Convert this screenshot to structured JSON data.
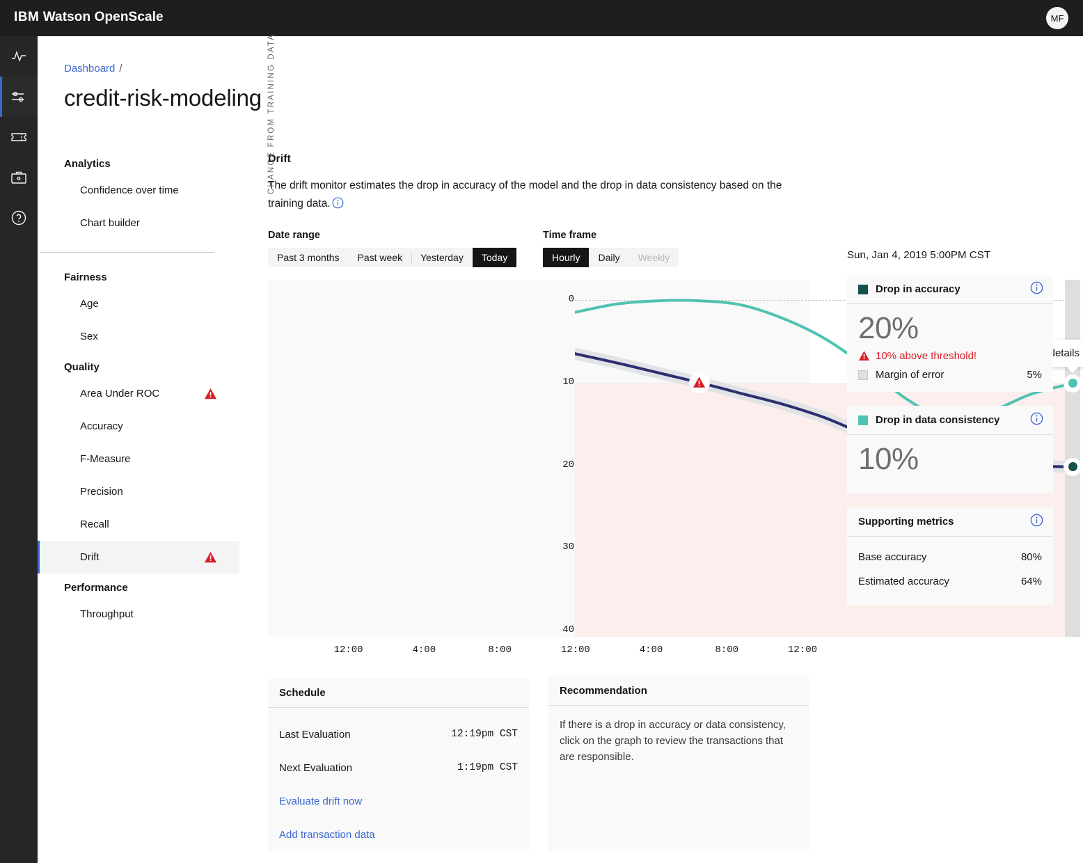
{
  "topbar": {
    "brand_ibm": "IBM",
    "brand_product": "Watson OpenScale",
    "avatar_initials": "MF"
  },
  "rail": {
    "items": [
      {
        "icon": "activity-icon",
        "active": false
      },
      {
        "icon": "sliders-icon",
        "active": true
      },
      {
        "icon": "ticket-icon",
        "active": false
      },
      {
        "icon": "briefcase-icon",
        "active": false
      },
      {
        "icon": "help-icon",
        "active": false
      }
    ]
  },
  "breadcrumb": {
    "parent": "Dashboard",
    "separator": "/"
  },
  "page_title": "credit-risk-modeling",
  "nav": {
    "groups": [
      {
        "heading": "Analytics",
        "items": [
          {
            "label": "Confidence over time",
            "warning": false,
            "selected": false
          },
          {
            "label": "Chart builder",
            "warning": false,
            "selected": false
          }
        ]
      },
      {
        "heading": "Fairness",
        "items": [
          {
            "label": "Age",
            "warning": false,
            "selected": false
          },
          {
            "label": "Sex",
            "warning": false,
            "selected": false
          }
        ]
      },
      {
        "heading": "Quality",
        "items": [
          {
            "label": "Area Under ROC",
            "warning": true,
            "selected": false
          },
          {
            "label": "Accuracy",
            "warning": false,
            "selected": false
          },
          {
            "label": "F-Measure",
            "warning": false,
            "selected": false
          },
          {
            "label": "Precision",
            "warning": false,
            "selected": false
          },
          {
            "label": "Recall",
            "warning": false,
            "selected": false
          },
          {
            "label": "Drift",
            "warning": true,
            "selected": true
          }
        ]
      },
      {
        "heading": "Performance",
        "items": [
          {
            "label": "Throughput",
            "warning": false,
            "selected": false
          }
        ]
      }
    ]
  },
  "section": {
    "title": "Drift",
    "description": "The drift monitor estimates the drop in accuracy of the model and the drop in data consistency based on the training data."
  },
  "controls": {
    "date_range": {
      "label": "Date range",
      "options": [
        "Past 3 months",
        "Past week",
        "Yesterday",
        "Today"
      ],
      "selected": "Today"
    },
    "time_frame": {
      "label": "Time frame",
      "options": [
        "Hourly",
        "Daily",
        "Weekly"
      ],
      "selected": "Hourly",
      "disabled": [
        "Weekly"
      ]
    }
  },
  "chart_tooltip": "Click to view details",
  "chart_data": {
    "type": "line",
    "title": "Drift",
    "xlabel": "",
    "ylabel": "CHANGE FROM TRAINING DATA",
    "x_ticks": [
      "12:00",
      "4:00",
      "8:00",
      "12:00",
      "4:00",
      "8:00",
      "12:00"
    ],
    "y_ticks": [
      0,
      10,
      20,
      30,
      40
    ],
    "ylim": [
      0,
      44
    ],
    "y_inverted": true,
    "grid": "horizontal-dashed",
    "legend_position": "right-panel",
    "threshold": 10,
    "threshold_band_color": "#fbeeec",
    "series": [
      {
        "name": "Drop in accuracy",
        "color": "#2d2f6f",
        "end_marker_color": "#17514f",
        "has_margin_band": true,
        "margin_band_color": "#dfe3e6",
        "margin_of_error": 5,
        "x": [
          0,
          4,
          8,
          12,
          16,
          20,
          24,
          28,
          32,
          36,
          40,
          44,
          48
        ],
        "values": [
          6.5,
          7.6,
          8.8,
          10.0,
          11.3,
          12.6,
          14.2,
          16.3,
          18.3,
          19.8,
          20.1,
          20.1,
          20.2
        ]
      },
      {
        "name": "Drop in data consistency",
        "color": "#4fc3b1",
        "end_marker_color": "#4fc3b1",
        "has_margin_band": false,
        "x": [
          0,
          4,
          8,
          12,
          16,
          20,
          24,
          28,
          32,
          36,
          40,
          44,
          48
        ],
        "values": [
          1.5,
          0.5,
          0.1,
          0.1,
          0.6,
          2.2,
          4.6,
          8.0,
          12.0,
          14.4,
          13.5,
          11.4,
          10.1
        ]
      }
    ],
    "alert_markers": [
      {
        "series": "Drop in accuracy",
        "x": 12,
        "y": 10.0,
        "icon": "warning-triangle"
      }
    ]
  },
  "metrics": {
    "timestamp": "Sun, Jan 4, 2019  5:00PM CST",
    "cards": [
      {
        "title": "Drop in accuracy",
        "swatch_color": "#17514f",
        "value": "20%",
        "alert": "10% above threshold!",
        "sub_label": "Margin of error",
        "sub_value": "5%"
      },
      {
        "title": "Drop in data consistency",
        "swatch_color": "#4fc3b1",
        "value": "10%"
      }
    ],
    "supporting": {
      "title": "Supporting metrics",
      "rows": [
        {
          "label": "Base accuracy",
          "value": "80%"
        },
        {
          "label": "Estimated accuracy",
          "value": "64%"
        }
      ]
    }
  },
  "schedule": {
    "title": "Schedule",
    "rows": [
      {
        "label": "Last Evaluation",
        "value": "12:19pm  CST"
      },
      {
        "label": "Next Evaluation",
        "value": "1:19pm  CST"
      }
    ],
    "links": [
      "Evaluate drift now",
      "Add transaction data"
    ]
  },
  "recommendation": {
    "title": "Recommendation",
    "text": "If there is a drop in accuracy or data consistency, click on the graph to review the transactions that are responsible."
  }
}
